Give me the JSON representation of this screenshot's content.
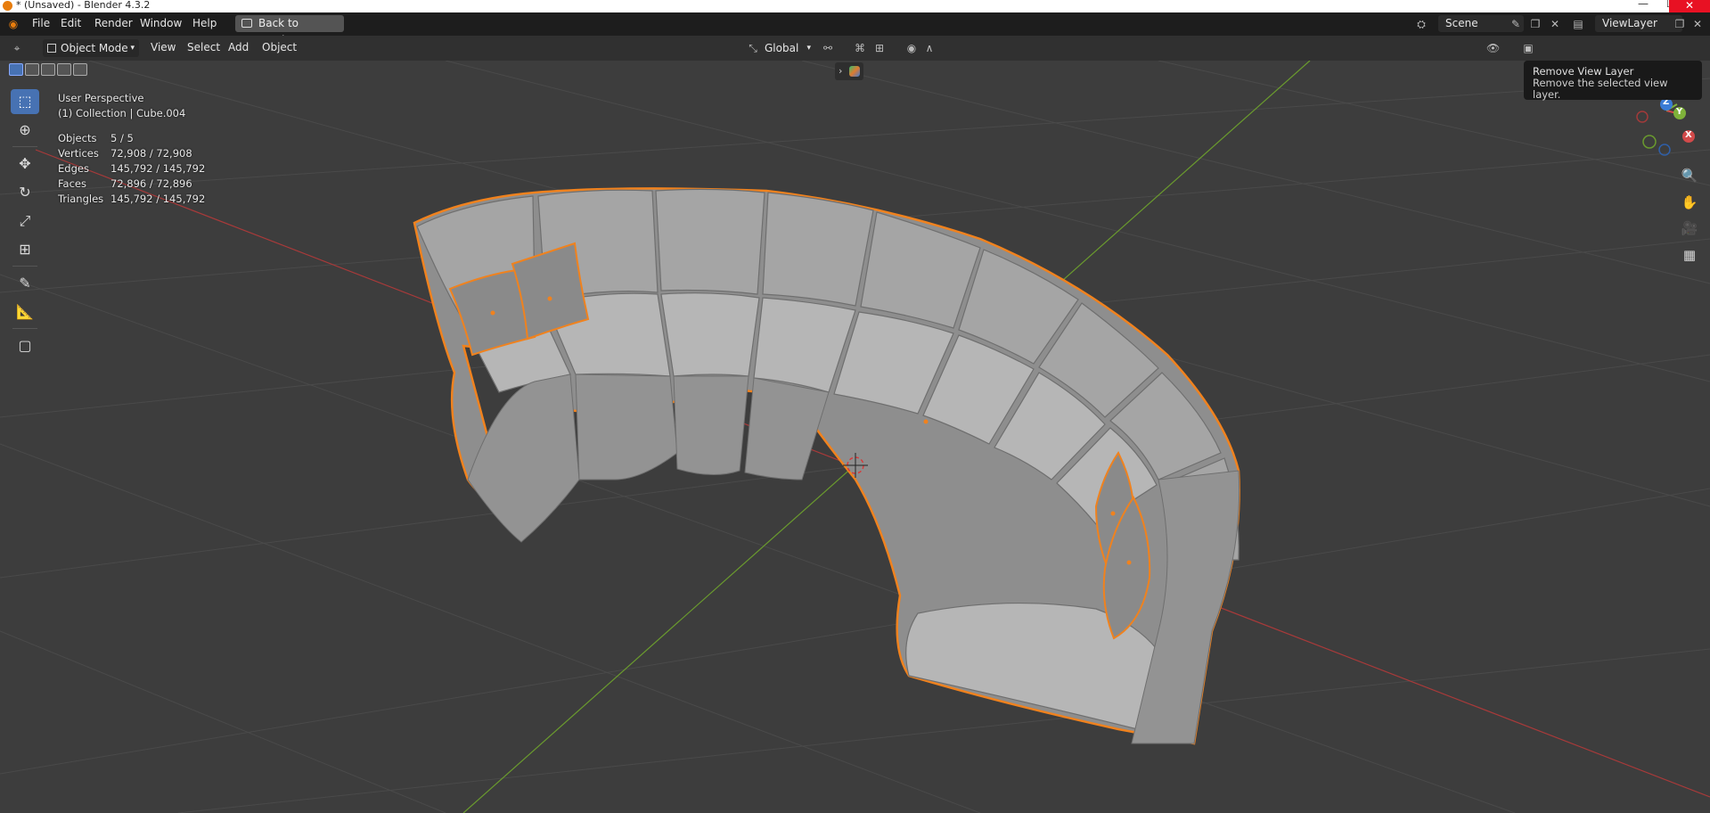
{
  "window": {
    "title": "* (Unsaved) - Blender 4.3.2",
    "close_label": "✕",
    "minimize_label": "—",
    "maximize_label": "☐"
  },
  "topbar": {
    "menu": [
      "File",
      "Edit",
      "Render",
      "Window",
      "Help"
    ],
    "back_button": "Back to Previous",
    "scene_label": "Scene",
    "view_layer_label": "ViewLayer"
  },
  "header": {
    "mode": "Object Mode",
    "menu": [
      "View",
      "Select",
      "Add",
      "Object"
    ],
    "transform_orientation": "Global"
  },
  "viewport": {
    "perspective": "User Perspective",
    "collection": "(1) Collection | Cube.004",
    "stats": [
      {
        "label": "Objects",
        "value": "5 / 5"
      },
      {
        "label": "Vertices",
        "value": "72,908 / 72,908"
      },
      {
        "label": "Edges",
        "value": "145,792 / 145,792"
      },
      {
        "label": "Faces",
        "value": "72,896 / 72,896"
      },
      {
        "label": "Triangles",
        "value": "145,792 / 145,792"
      }
    ],
    "gizmo": {
      "x": "X",
      "y": "Y",
      "z": "Z"
    }
  },
  "tooltip": {
    "title": "Remove View Layer",
    "description": "Remove the selected view layer."
  },
  "colors": {
    "selection_outline": "#f0821e",
    "active_tool": "#4772b3",
    "axis_x": "#d24a4a",
    "axis_y": "#7fb23a"
  }
}
